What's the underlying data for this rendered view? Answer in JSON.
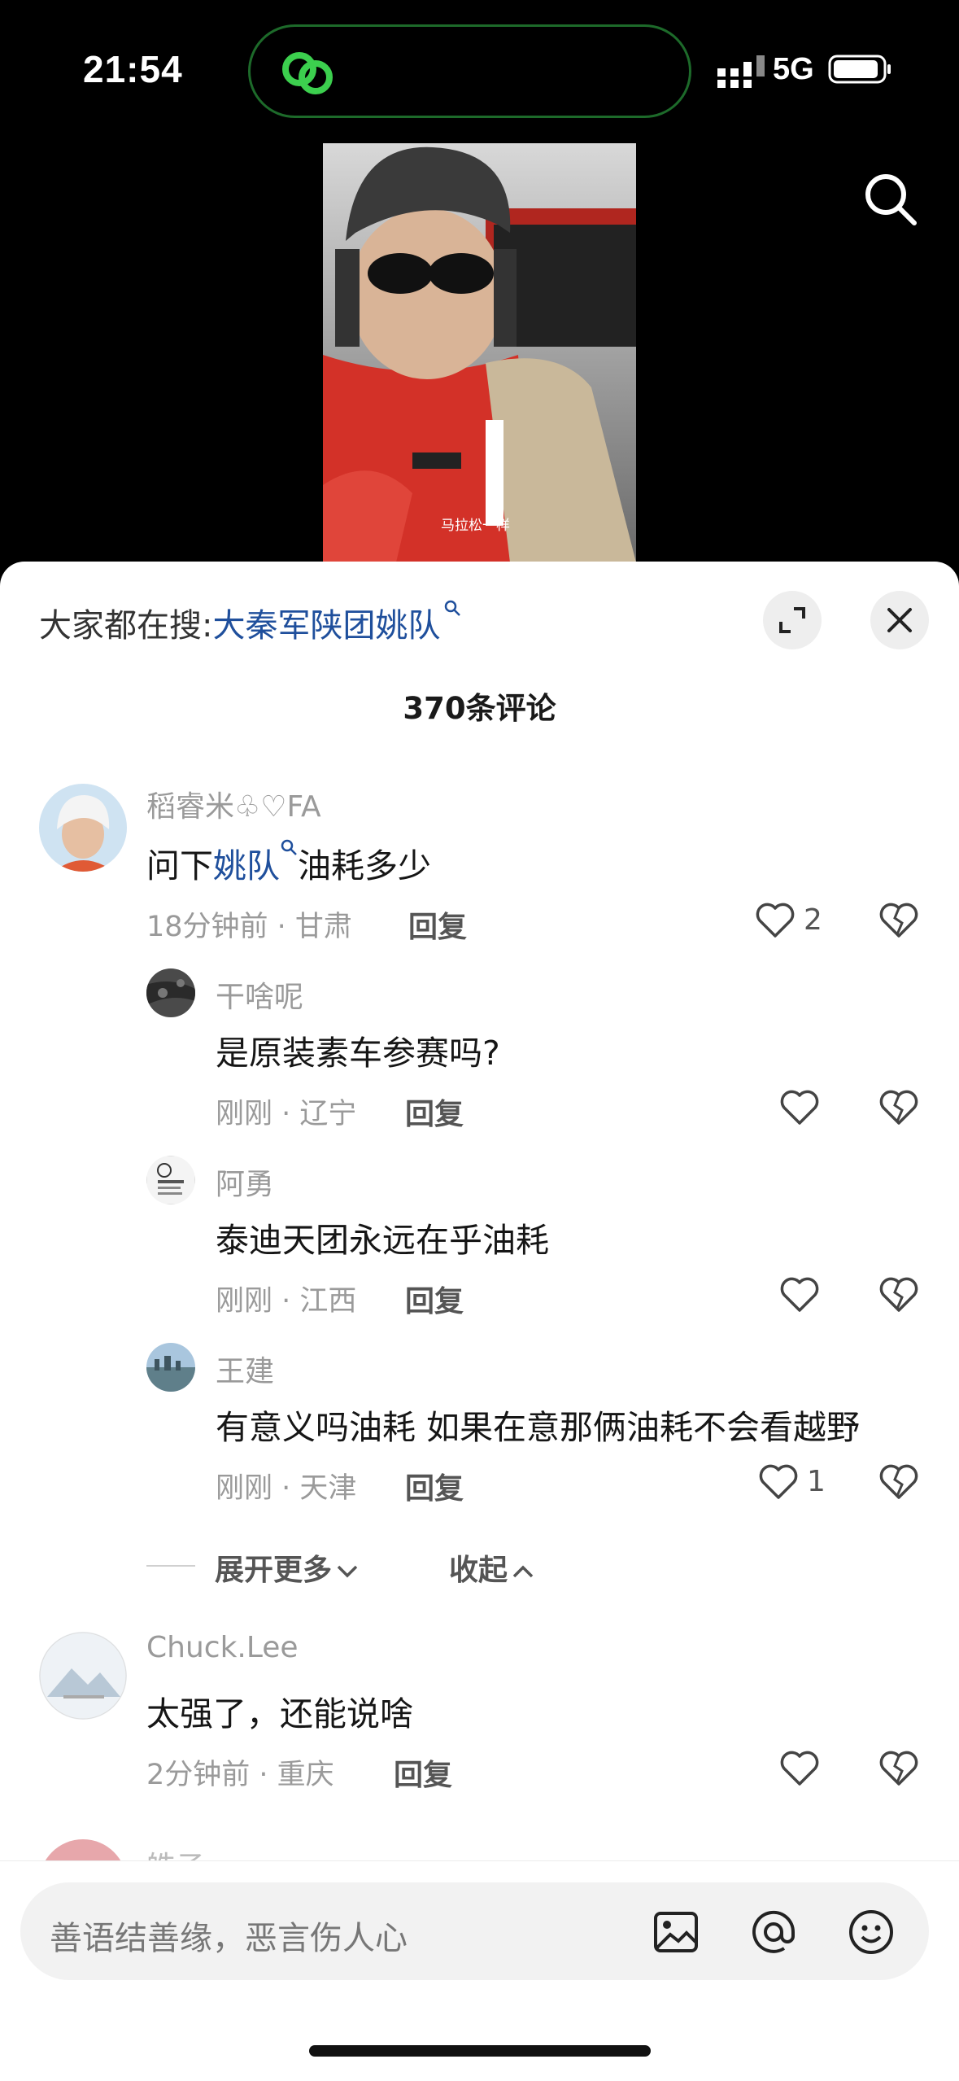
{
  "status_bar": {
    "time": "21:54",
    "network": "5G"
  },
  "search_hint": {
    "prefix": "大家都在搜:",
    "term": "大秦军陕团姚队"
  },
  "comments_count": "370条评论",
  "comments": [
    {
      "username": "稻睿米♧♡FA",
      "text_before": "问下",
      "keyword": "姚队",
      "text_after": "油耗多少",
      "meta": "18分钟前 · 甘肃",
      "reply_label": "回复",
      "likes": "2",
      "replies": [
        {
          "username": "干啥呢",
          "text": "是原装素车参赛吗?",
          "meta": "刚刚 · 辽宁",
          "reply_label": "回复",
          "likes": ""
        },
        {
          "username": "阿勇",
          "text": "泰迪天团永远在乎油耗",
          "meta": "刚刚 · 江西",
          "reply_label": "回复",
          "likes": ""
        },
        {
          "username": "王建",
          "text": "有意义吗油耗 如果在意那俩油耗不会看越野",
          "meta": "刚刚 · 天津",
          "reply_label": "回复",
          "likes": "1"
        }
      ]
    },
    {
      "username": "Chuck.Lee",
      "text": "太强了，还能说啥",
      "meta": "2分钟前 · 重庆",
      "reply_label": "回复",
      "likes": ""
    }
  ],
  "expand_more": "展开更多",
  "collapse": "收起",
  "next_commenter_partial": "皓子",
  "video_caption": "马拉松一样",
  "input": {
    "placeholder": "善语结善缘，恶言伤人心"
  },
  "colors": {
    "link": "#1f4f9c",
    "island_border": "#1d6a2a",
    "island_icon": "#3ccf4e"
  },
  "icons": [
    "search-icon",
    "expand-icon",
    "close-icon",
    "heart-icon",
    "broken-heart-icon",
    "image-icon",
    "at-icon",
    "emoji-icon",
    "link-icon"
  ]
}
